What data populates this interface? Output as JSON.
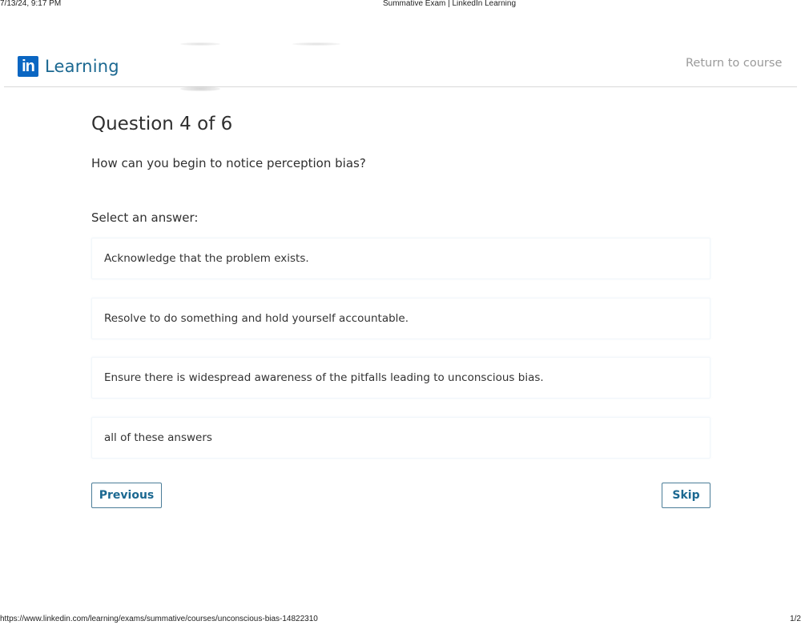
{
  "print_header": {
    "datetime": "7/13/24, 9:17 PM",
    "page_title": "Summative Exam | LinkedIn Learning"
  },
  "print_footer": {
    "url": "https://www.linkedin.com/learning/exams/summative/courses/unconscious-bias-14822310",
    "page_count": "1/2"
  },
  "header": {
    "logo_mark": "in",
    "logo_text": "Learning",
    "return_link": "Return to course",
    "brand_color": "#0a66c2"
  },
  "exam": {
    "question_title": "Question 4 of 6",
    "question_number": 4,
    "question_total": 6,
    "question_text": "How can you begin to notice perception bias?",
    "select_label": "Select an answer:",
    "answers": [
      {
        "label": "Acknowledge that the problem exists."
      },
      {
        "label": "Resolve to do something and hold yourself accountable."
      },
      {
        "label": "Ensure there is widespread awareness of the pitfalls leading to unconscious bias."
      },
      {
        "label": "all of these answers"
      }
    ],
    "previous_label": "Previous",
    "skip_label": "Skip"
  }
}
